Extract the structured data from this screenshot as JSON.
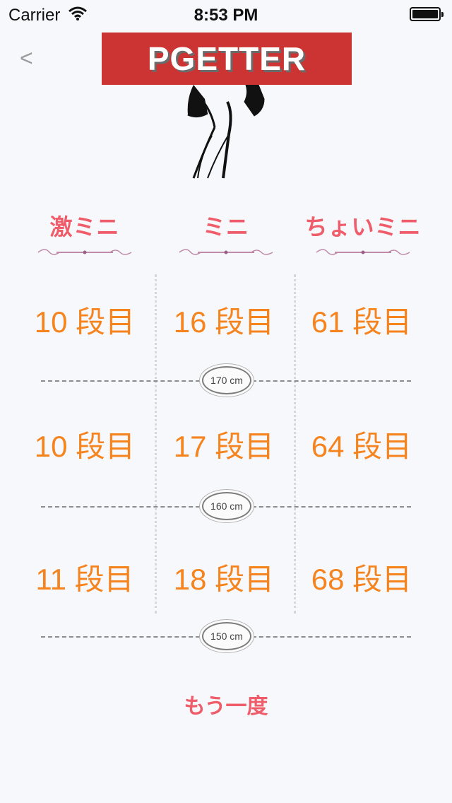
{
  "status_bar": {
    "carrier": "Carrier",
    "time": "8:53 PM"
  },
  "nav": {
    "back_label": "<",
    "logo_text": "PGETTER"
  },
  "columns": [
    {
      "label": "激ミニ"
    },
    {
      "label": "ミニ"
    },
    {
      "label": "ちょいミニ"
    }
  ],
  "rows": [
    {
      "cells": [
        "10 段目",
        "16 段目",
        "61 段目"
      ],
      "height_label": "170 cm"
    },
    {
      "cells": [
        "10 段目",
        "17 段目",
        "64 段目"
      ],
      "height_label": "160 cm"
    },
    {
      "cells": [
        "11 段目",
        "18 段目",
        "68 段目"
      ],
      "height_label": "150 cm"
    }
  ],
  "retry_label": "もう一度",
  "colors": {
    "logo_bg": "#cc3333",
    "header_pink": "#ef5c6a",
    "value_orange": "#f5841f"
  }
}
